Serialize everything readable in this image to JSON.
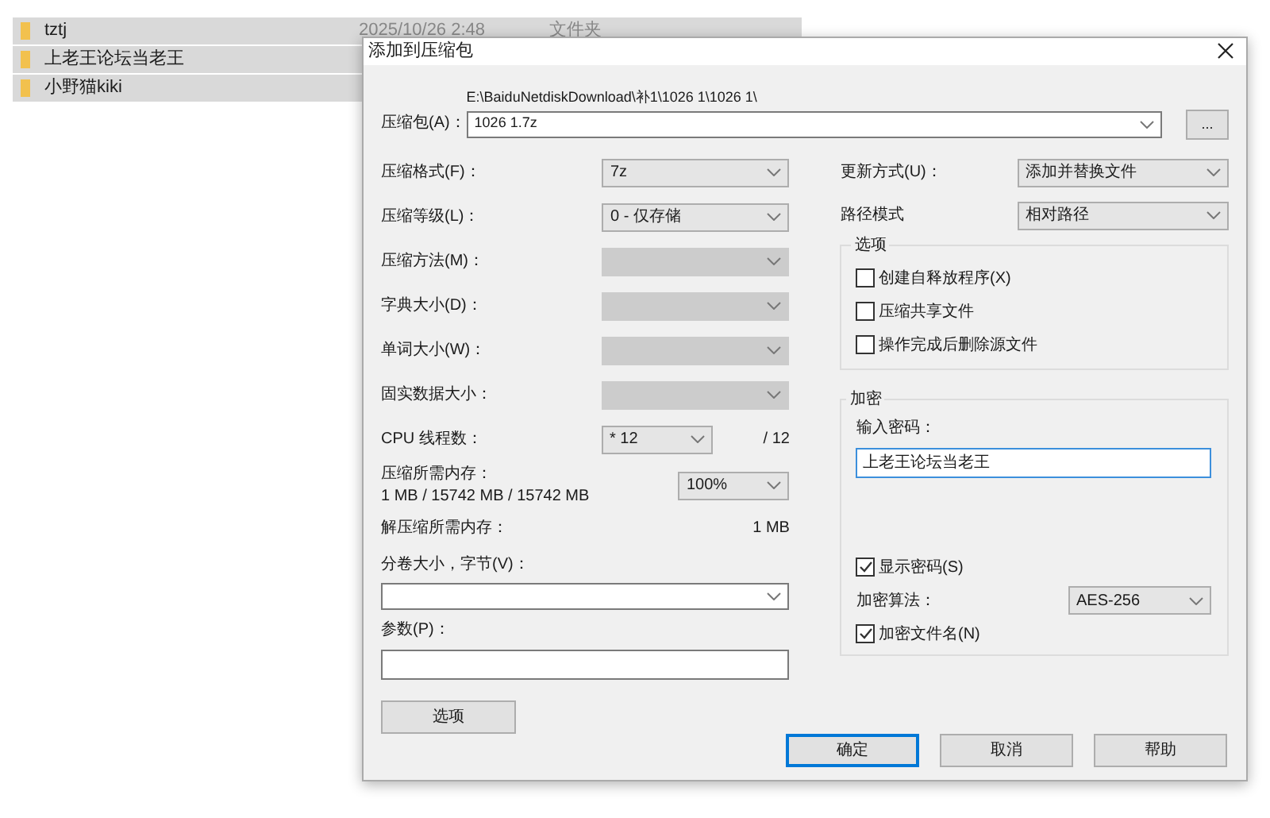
{
  "explorer": {
    "rows": [
      {
        "name": "tztj",
        "date": "2025/10/26 2:48",
        "type": "文件夹",
        "selected": true
      },
      {
        "name": "上老王论坛当老王",
        "selected": true
      },
      {
        "name": "小野猫kiki",
        "selected": true
      }
    ]
  },
  "dialog": {
    "title": "添加到压缩包",
    "archive": {
      "label": "压缩包(A)：",
      "path": "E:\\BaiduNetdiskDownload\\补1\\1026 1\\1026 1\\",
      "value": "1026 1.7z",
      "browse": "..."
    },
    "left_rows": [
      {
        "kind": "select",
        "label": "压缩格式(F)：",
        "value": "7z",
        "disabled": false
      },
      {
        "kind": "select",
        "label": "压缩等级(L)：",
        "value": "0 - 仅存储",
        "disabled": false
      },
      {
        "kind": "select",
        "label": "压缩方法(M)：",
        "disabled": true
      },
      {
        "kind": "select",
        "label": "字典大小(D)：",
        "disabled": true
      },
      {
        "kind": "select",
        "label": "单词大小(W)：",
        "disabled": true
      },
      {
        "kind": "select",
        "label": "固实数据大小：",
        "disabled": true
      },
      {
        "kind": "threads",
        "label": "CPU 线程数：",
        "value": "* 12",
        "total": "/ 12"
      },
      {
        "kind": "memory",
        "label": "压缩所需内存：",
        "detail": "1 MB / 15742 MB / 15742 MB",
        "value": "100%"
      },
      {
        "kind": "info",
        "label": "解压缩所需内存：",
        "value": "1 MB"
      },
      {
        "kind": "combo",
        "label": "分卷大小，字节(V)："
      },
      {
        "kind": "input",
        "label": "参数(P)："
      }
    ],
    "options_button": "选项",
    "update": {
      "label": "更新方式(U)：",
      "value": "添加并替换文件"
    },
    "path_mode": {
      "label": "路径模式",
      "value": "相对路径"
    },
    "options_group": {
      "title": "选项",
      "items": [
        {
          "label": "创建自释放程序(X)",
          "checked": false
        },
        {
          "label": "压缩共享文件",
          "checked": false
        },
        {
          "label": "操作完成后删除源文件",
          "checked": false
        }
      ]
    },
    "encryption": {
      "title": "加密",
      "password_label": "输入密码：",
      "password": "上老王论坛当老王",
      "show_password": {
        "label": "显示密码(S)",
        "checked": true
      },
      "method_label": "加密算法：",
      "method": "AES-256",
      "encrypt_names": {
        "label": "加密文件名(N)",
        "checked": true
      }
    },
    "buttons": [
      {
        "label": "确定",
        "focused": true
      },
      {
        "label": "取消",
        "focused": false
      },
      {
        "label": "帮助",
        "focused": false
      }
    ]
  }
}
